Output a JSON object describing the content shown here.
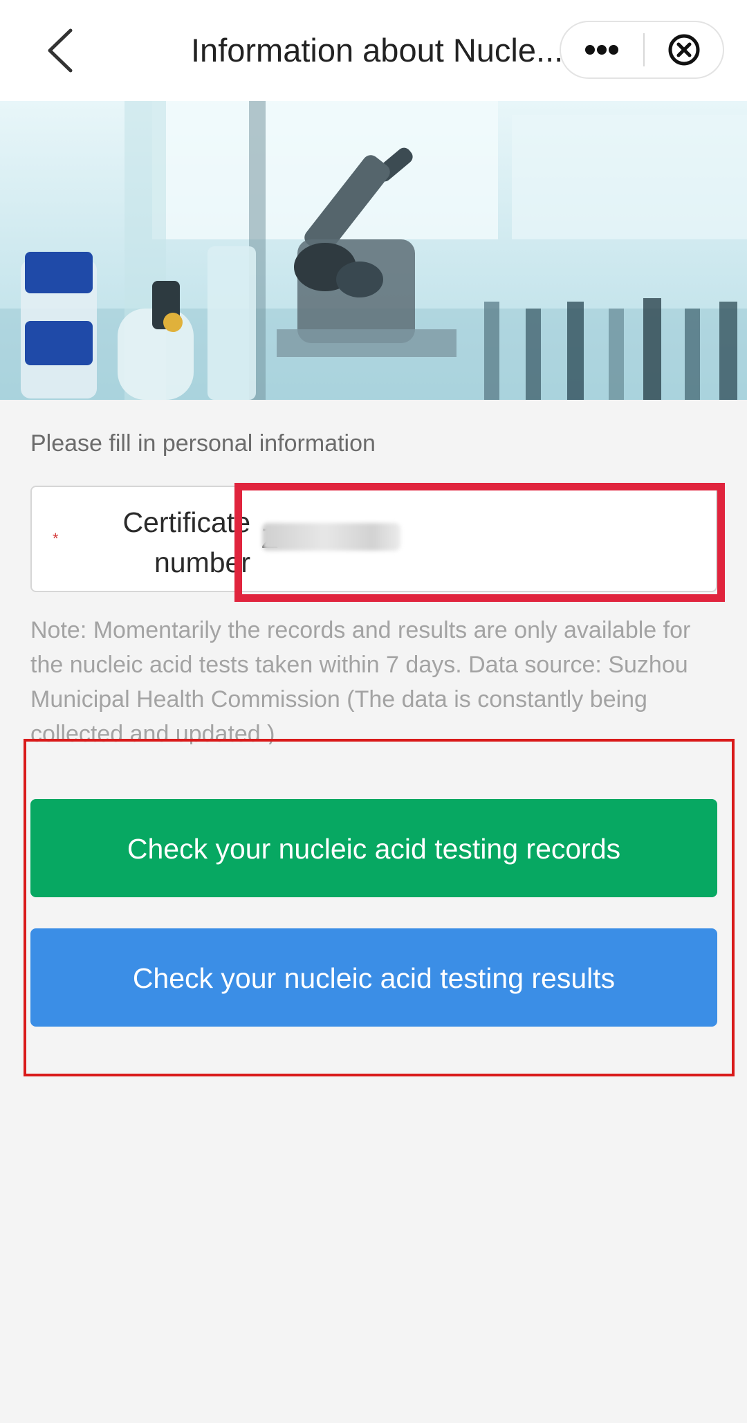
{
  "header": {
    "title": "Information about Nucle...",
    "back_icon": "chevron-left-icon",
    "more_icon": "more-dots-icon",
    "close_icon": "circle-x-icon"
  },
  "form": {
    "section_label": "Please fill in personal information",
    "required_marker": "*",
    "field_label_line1": "Certificate",
    "field_label_line2": "number",
    "certificate_value": "Z"
  },
  "note": "Note: Momentarily the records and results are only available for the nucleic acid tests taken within 7 days. Data source: Suzhou Municipal Health Commission (The data is constantly being collected and updated.)",
  "buttons": {
    "records_label": "Check your nucleic acid testing records",
    "results_label": "Check your nucleic acid testing results"
  },
  "colors": {
    "records_button": "#07a862",
    "results_button": "#3b8ee6",
    "highlight_box": "#e0243d"
  }
}
